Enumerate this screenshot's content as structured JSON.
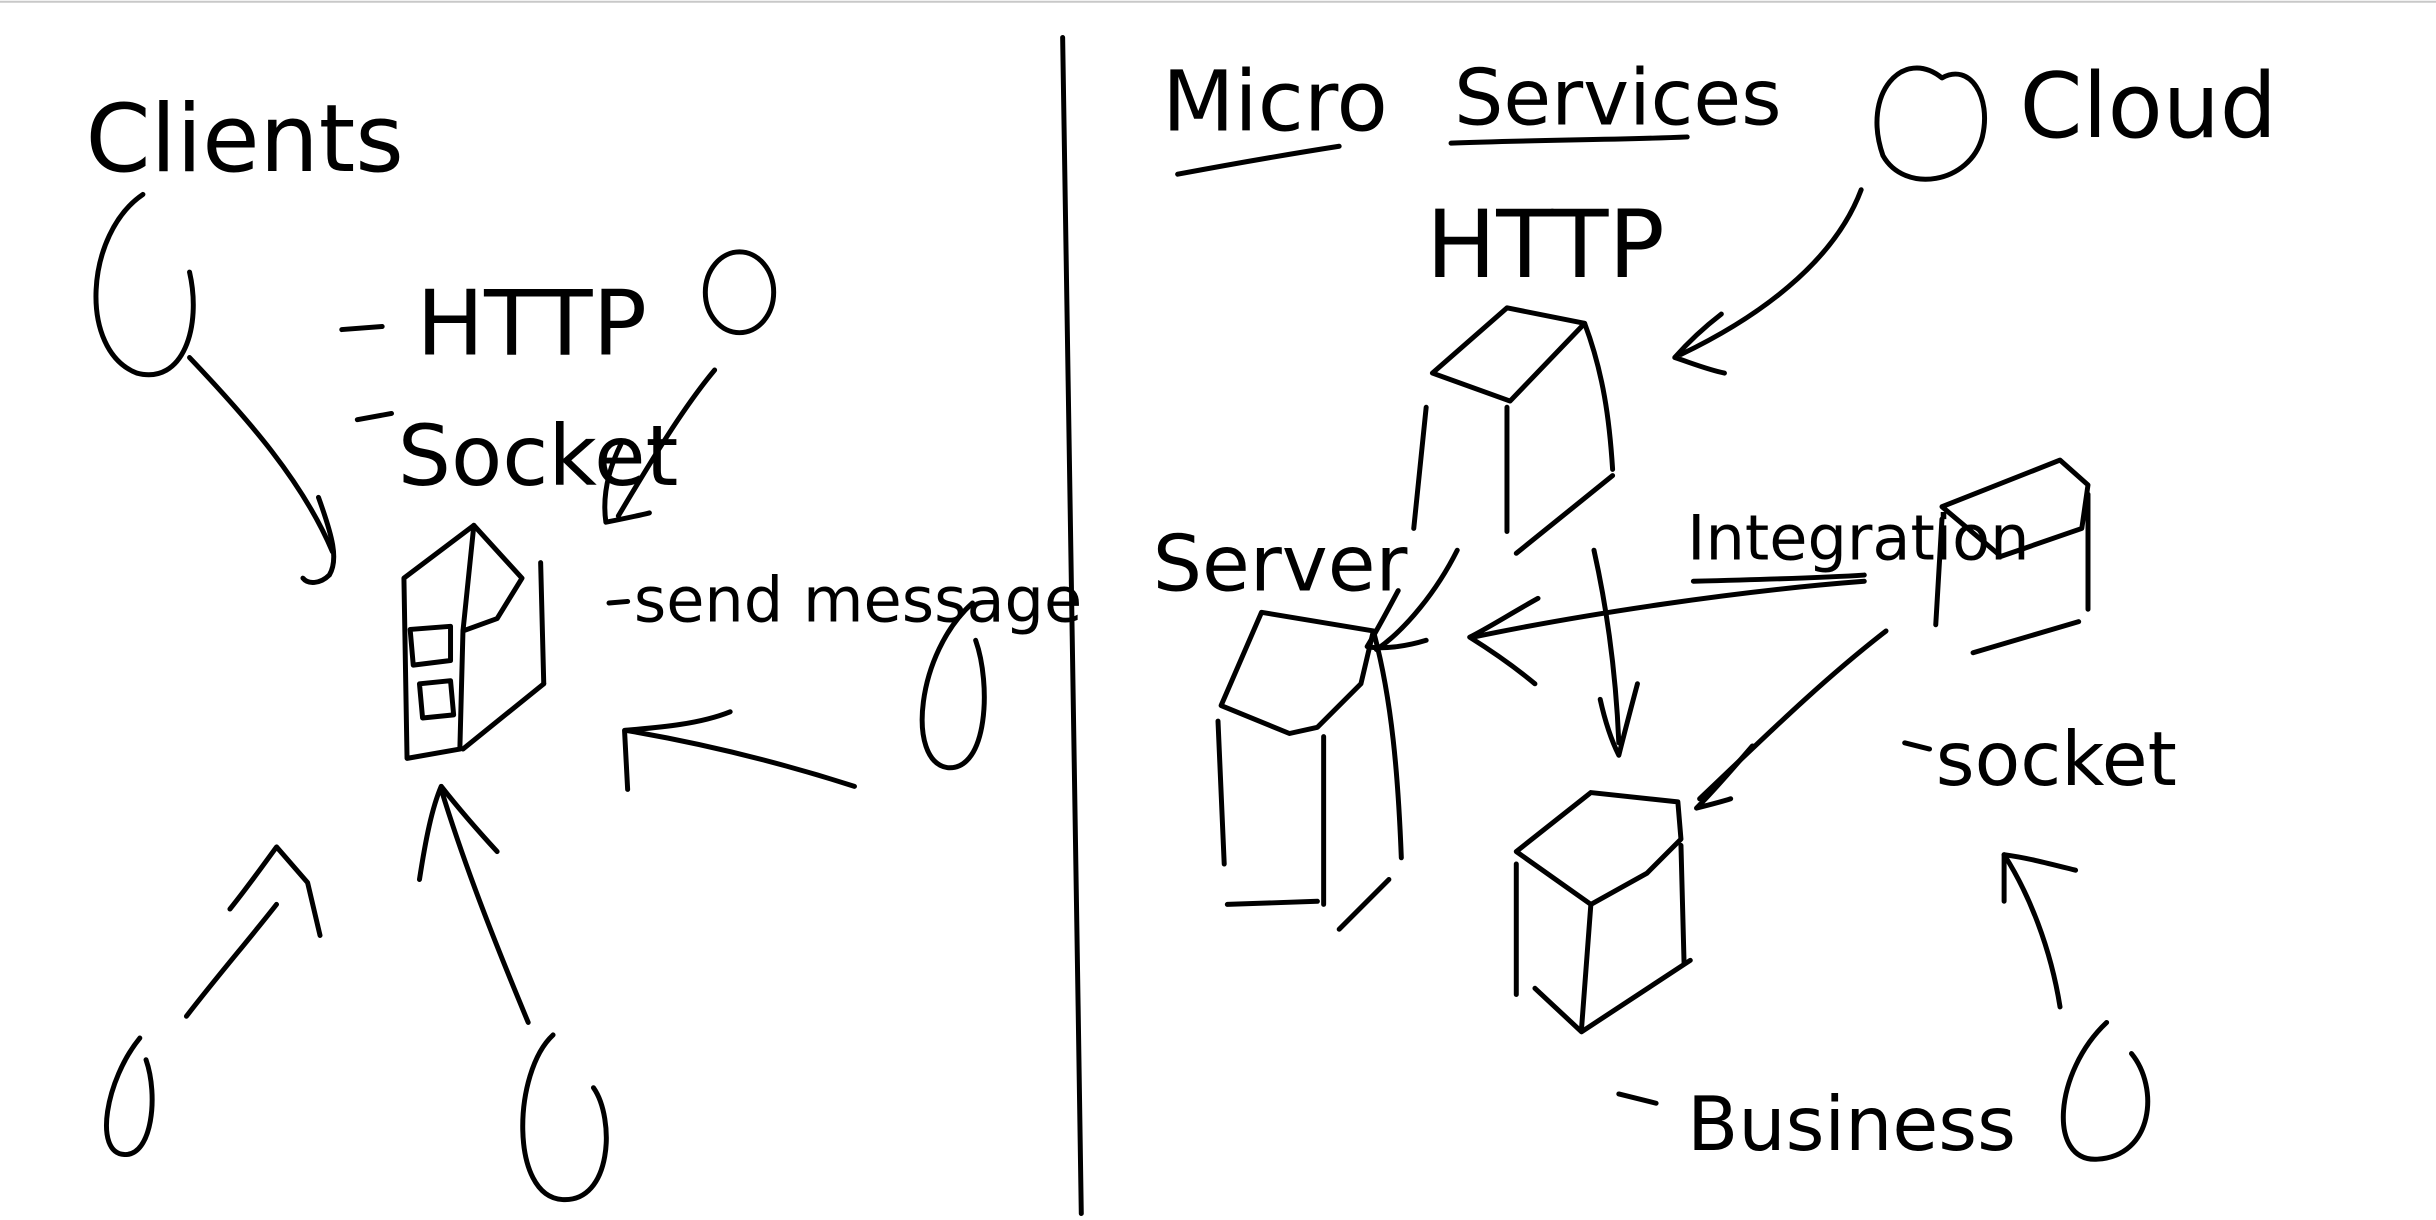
{
  "ink_color": "#000000",
  "background": "#ffffff",
  "left": {
    "title": "Clients",
    "protocol_http": "HTTP",
    "protocol_socket": "Socket",
    "send_message": "send message"
  },
  "right": {
    "title_part1": "Micro",
    "title_part2": "Services",
    "cloud_label": "Cloud",
    "http_label": "HTTP",
    "server_label": "Server",
    "integration_label": "Integration",
    "socket_label": "socket",
    "business_label": "Business"
  }
}
